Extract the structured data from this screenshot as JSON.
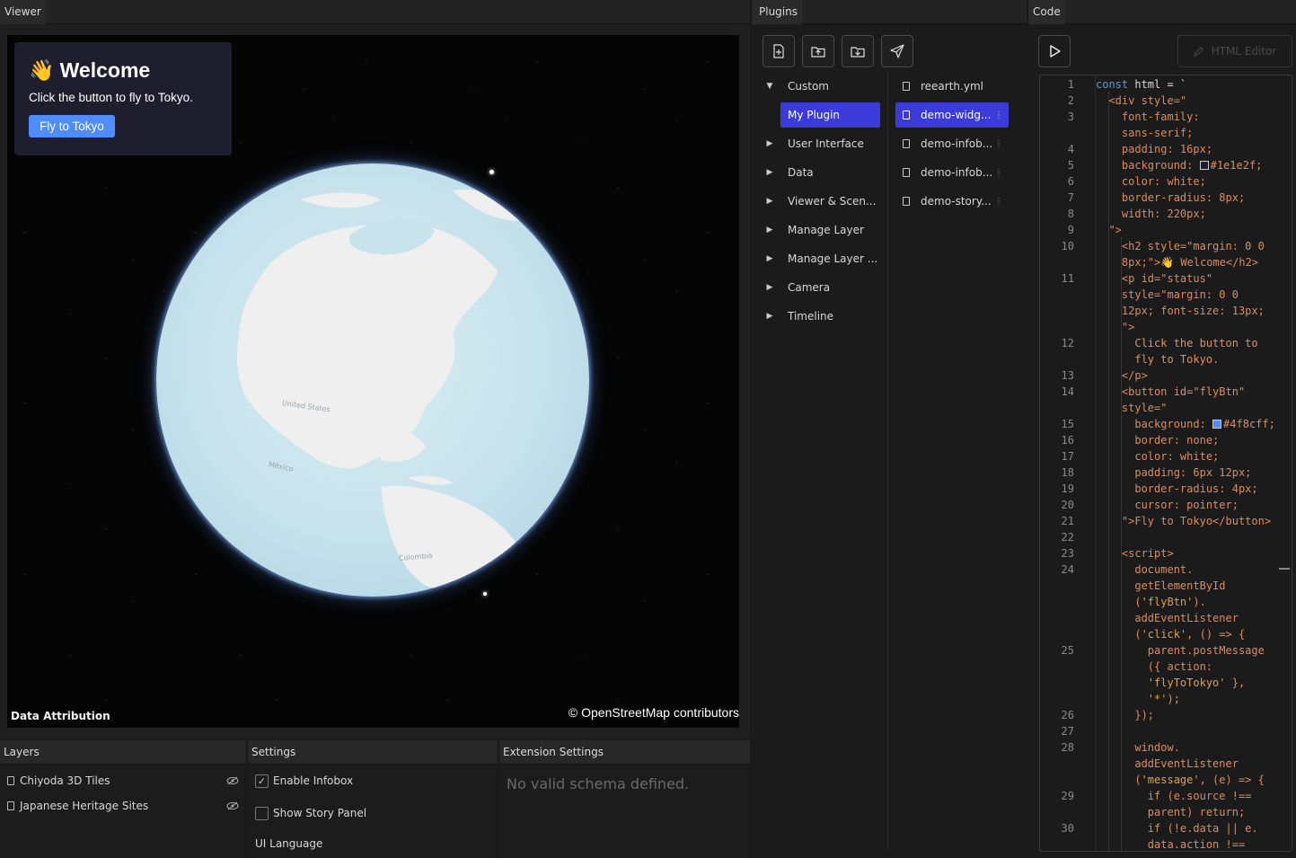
{
  "viewer": {
    "tab": "Viewer",
    "welcome": {
      "emoji": "👋",
      "title": "Welcome",
      "status": "Click the button to fly to Tokyo.",
      "button": "Fly to Tokyo"
    },
    "map_labels": [
      "United States",
      "México",
      "Colombia"
    ],
    "attribution_left": "Data Attribution",
    "attribution_right": "© OpenStreetMap contributors"
  },
  "layers": {
    "tab": "Layers",
    "items": [
      {
        "label": "Chiyoda 3D Tiles"
      },
      {
        "label": "Japanese Heritage Sites"
      }
    ]
  },
  "settings": {
    "tab": "Settings",
    "items": [
      {
        "label": "Enable Infobox",
        "checked": true
      },
      {
        "label": "Show Story Panel",
        "checked": false
      }
    ],
    "ui_language_label": "UI Language"
  },
  "extension_settings": {
    "tab": "Extension Settings",
    "message": "No valid schema defined."
  },
  "plugins": {
    "tab": "Plugins",
    "toolbar_icons": [
      "new-file-icon",
      "upload-icon",
      "download-icon",
      "send-icon"
    ],
    "categories": [
      {
        "label": "Custom",
        "expanded": true
      },
      {
        "label": "My Plugin",
        "selected": true
      },
      {
        "label": "User Interface"
      },
      {
        "label": "Data"
      },
      {
        "label": "Viewer & Scen..."
      },
      {
        "label": "Manage Layer"
      },
      {
        "label": "Manage Layer ..."
      },
      {
        "label": "Camera"
      },
      {
        "label": "Timeline"
      }
    ],
    "files": [
      {
        "name": "reearth.yml"
      },
      {
        "name": "demo-widg...",
        "selected": true
      },
      {
        "name": "demo-infob..."
      },
      {
        "name": "demo-infob..."
      },
      {
        "name": "demo-story..."
      }
    ]
  },
  "code": {
    "tab": "Code",
    "html_editor_label": "HTML Editor",
    "line_numbers": [
      "1",
      "2",
      "3",
      "",
      "4",
      "5",
      "6",
      "7",
      "8",
      "9",
      "10",
      "",
      "11",
      "",
      "",
      "",
      "12",
      "",
      "13",
      "14",
      "",
      "15",
      "16",
      "17",
      "18",
      "19",
      "20",
      "21",
      "22",
      "23",
      "24",
      "",
      "",
      "",
      "",
      "25",
      "",
      "",
      "",
      "26",
      "27",
      "28",
      "",
      "",
      "29",
      "",
      "30",
      ""
    ],
    "lines": [
      [
        [
          "kw",
          "const "
        ],
        [
          "var",
          "html = `"
        ]
      ],
      [
        [
          "tag",
          "  <div style=\""
        ]
      ],
      [
        [
          "tag",
          "    font-family:"
        ]
      ],
      [
        [
          "tag",
          "    sans-serif;"
        ]
      ],
      [
        [
          "tag",
          "    padding: 16px;"
        ]
      ],
      [
        [
          "tag",
          "    background: "
        ],
        [
          "swatch",
          "#1e1e2f"
        ],
        [
          "tag",
          "#1e1e2f;"
        ]
      ],
      [
        [
          "tag",
          "    color: white;"
        ]
      ],
      [
        [
          "tag",
          "    border-radius: 8px;"
        ]
      ],
      [
        [
          "tag",
          "    width: 220px;"
        ]
      ],
      [
        [
          "tag",
          "  \">"
        ]
      ],
      [
        [
          "tag",
          "    <h2 style=\"margin: 0 0"
        ]
      ],
      [
        [
          "tag",
          "    8px;\">👋 Welcome</h2>"
        ]
      ],
      [
        [
          "tag",
          "    <p id=\"status\""
        ]
      ],
      [
        [
          "tag",
          "    style=\"margin: 0 0"
        ]
      ],
      [
        [
          "tag",
          "    12px; font-size: 13px;"
        ]
      ],
      [
        [
          "tag",
          "    \">"
        ]
      ],
      [
        [
          "text",
          "      Click the button to"
        ]
      ],
      [
        [
          "text",
          "      fly to Tokyo."
        ]
      ],
      [
        [
          "tag",
          "    </p>"
        ]
      ],
      [
        [
          "tag",
          "    <button id=\"flyBtn\""
        ]
      ],
      [
        [
          "tag",
          "    style=\""
        ]
      ],
      [
        [
          "tag",
          "      background: "
        ],
        [
          "swatch",
          "#4f8cff"
        ],
        [
          "tag",
          "#4f8cff;"
        ]
      ],
      [
        [
          "tag",
          "      border: none;"
        ]
      ],
      [
        [
          "tag",
          "      color: white;"
        ]
      ],
      [
        [
          "tag",
          "      padding: 6px 12px;"
        ]
      ],
      [
        [
          "tag",
          "      border-radius: 4px;"
        ]
      ],
      [
        [
          "tag",
          "      cursor: pointer;"
        ]
      ],
      [
        [
          "tag",
          "    \">Fly to Tokyo</button>"
        ]
      ],
      [
        [
          "var",
          ""
        ]
      ],
      [
        [
          "tag",
          "    <script>"
        ]
      ],
      [
        [
          "tag",
          "      document."
        ]
      ],
      [
        [
          "tag",
          "      getElementById"
        ]
      ],
      [
        [
          "tag",
          "      ("
        ],
        [
          "str",
          "'flyBtn'"
        ],
        [
          "tag",
          ")."
        ]
      ],
      [
        [
          "tag",
          "      addEventListener"
        ]
      ],
      [
        [
          "tag",
          "      ("
        ],
        [
          "str",
          "'click'"
        ],
        [
          "tag",
          ", () => {"
        ]
      ],
      [
        [
          "tag",
          "        parent.postMessage"
        ]
      ],
      [
        [
          "tag",
          "        ({ action:"
        ]
      ],
      [
        [
          "str",
          "        'flyToTokyo'"
        ],
        [
          "tag",
          " },"
        ]
      ],
      [
        [
          "str",
          "        '*'"
        ],
        [
          "tag",
          ");"
        ]
      ],
      [
        [
          "tag",
          "      });"
        ]
      ],
      [
        [
          "var",
          ""
        ]
      ],
      [
        [
          "tag",
          "      window."
        ]
      ],
      [
        [
          "tag",
          "      addEventListener"
        ]
      ],
      [
        [
          "tag",
          "      ("
        ],
        [
          "str",
          "'message'"
        ],
        [
          "tag",
          ", (e) => {"
        ]
      ],
      [
        [
          "tag",
          "        if (e.source !=="
        ]
      ],
      [
        [
          "tag",
          "        parent) return;"
        ]
      ],
      [
        [
          "tag",
          "        if (!e.data || e."
        ]
      ],
      [
        [
          "tag",
          "        data.action !=="
        ]
      ]
    ]
  }
}
